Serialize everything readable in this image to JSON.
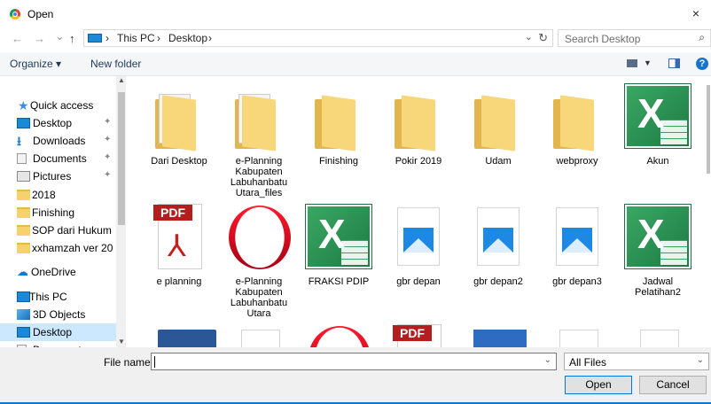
{
  "window": {
    "title": "Open",
    "close_glyph": "×"
  },
  "address": {
    "back_glyph": "←",
    "forward_glyph": "→",
    "recent_glyph": "⌄",
    "up_glyph": "↑",
    "crumbs": [
      "This PC",
      "Desktop"
    ],
    "separator": "›",
    "dropdown_glyph": "⌄",
    "refresh_glyph": "↻"
  },
  "search": {
    "placeholder": "Search Desktop",
    "icon": "search-icon",
    "glyph": "⌕"
  },
  "toolbar": {
    "organize_label": "Organize ▾",
    "new_folder_label": "New folder",
    "help_glyph": "?",
    "view_dd_glyph": "▼"
  },
  "sidebar": {
    "items": [
      {
        "label": "Quick access",
        "icon": "star-icon",
        "pinned": false
      },
      {
        "label": "Desktop",
        "icon": "desktop-icon",
        "pinned": true
      },
      {
        "label": "Downloads",
        "icon": "download-icon",
        "pinned": true
      },
      {
        "label": "Documents",
        "icon": "documents-icon",
        "pinned": true
      },
      {
        "label": "Pictures",
        "icon": "pictures-icon",
        "pinned": true
      },
      {
        "label": "2018",
        "icon": "folder-icon",
        "pinned": false
      },
      {
        "label": "Finishing",
        "icon": "folder-icon",
        "pinned": false
      },
      {
        "label": "SOP dari Hukum",
        "icon": "folder-icon",
        "pinned": false
      },
      {
        "label": "xxhamzah ver 20",
        "icon": "folder-icon",
        "pinned": false
      },
      {
        "label": "OneDrive",
        "icon": "onedrive-icon",
        "pinned": false
      },
      {
        "label": "This PC",
        "icon": "pc-icon",
        "pinned": false
      },
      {
        "label": "3D Objects",
        "icon": "3d-objects-icon",
        "pinned": false
      },
      {
        "label": "Desktop",
        "icon": "desktop-icon",
        "pinned": false,
        "selected": true
      },
      {
        "label": "Documents",
        "icon": "documents-icon",
        "pinned": false
      }
    ],
    "pin_glyph": "✦",
    "scroll_up_glyph": "▲",
    "scroll_down_glyph": "▼"
  },
  "files": [
    {
      "label": "Dari Desktop",
      "type": "folder-with-paper"
    },
    {
      "label": "e-Planning Kabupaten Labuhanbatu Utara_files",
      "type": "folder-with-paper"
    },
    {
      "label": "Finishing",
      "type": "folder"
    },
    {
      "label": "Pokir 2019",
      "type": "folder"
    },
    {
      "label": "Udam",
      "type": "folder"
    },
    {
      "label": "webproxy",
      "type": "folder"
    },
    {
      "label": "Akun",
      "type": "excel"
    },
    {
      "label": "e planning",
      "type": "pdf"
    },
    {
      "label": "e-Planning Kabupaten Labuhanbatu Utara",
      "type": "opera"
    },
    {
      "label": "FRAKSI PDIP",
      "type": "excel"
    },
    {
      "label": "gbr depan",
      "type": "image"
    },
    {
      "label": "gbr depan2",
      "type": "image"
    },
    {
      "label": "gbr depan3",
      "type": "image"
    },
    {
      "label": "Jadwal Pelatihan2",
      "type": "excel"
    },
    {
      "label": "",
      "type": "word"
    },
    {
      "label": "",
      "type": "blank"
    },
    {
      "label": "",
      "type": "opera"
    },
    {
      "label": "",
      "type": "pdf"
    },
    {
      "label": "",
      "type": "ppt"
    },
    {
      "label": "",
      "type": "blank"
    },
    {
      "label": "",
      "type": "blank"
    }
  ],
  "icon_text": {
    "excel_letter": "X",
    "pdf_band": "PDF",
    "pdf_mark": "⅄"
  },
  "bottom": {
    "file_name_label": "File name:",
    "file_name_value": "",
    "filter_value": "All Files",
    "dropdown_glyph": "⌄",
    "open_label": "Open",
    "cancel_label": "Cancel"
  },
  "colors": {
    "accent": "#0078d7",
    "selected_bg": "#cce8ff",
    "folder": "#f7d77a"
  }
}
